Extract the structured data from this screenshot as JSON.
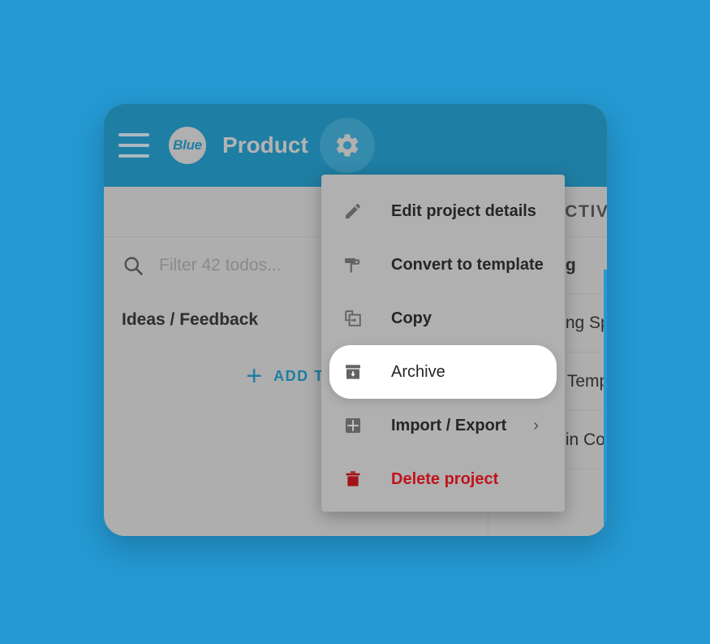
{
  "page": {
    "background_color": "#2499d3"
  },
  "window": {
    "header": {
      "background_color": "#1f7ea3",
      "menu_icon": "hamburger-menu-icon",
      "logo_text": "Blue",
      "project_title": "Product",
      "settings_icon": "gear-icon"
    },
    "board": {
      "tabs": [
        {
          "label": "ACTIVITY"
        }
      ],
      "filter": {
        "icon": "search-icon",
        "placeholder": "Filter 42 todos...",
        "value": ""
      },
      "columns": [
        {
          "title": "Ideas / Feedback",
          "add_button": {
            "icon": "plus-icon",
            "label": "ADD TODO"
          },
          "tasks": []
        },
        {
          "title": "Backlog",
          "tasks": [
            {
              "label": "Improving Speed"
            },
            {
              "label": "Project Templates"
            },
            {
              "label": "Emails in Comments"
            }
          ]
        }
      ]
    }
  },
  "settings_menu": {
    "items": [
      {
        "label": "Edit project details",
        "icon": "pencil-icon",
        "highlighted": false,
        "danger": false,
        "has_submenu": false
      },
      {
        "label": "Convert to template",
        "icon": "paint-roller-icon",
        "highlighted": false,
        "danger": false,
        "has_submenu": false
      },
      {
        "label": "Copy",
        "icon": "copy-icon",
        "highlighted": false,
        "danger": false,
        "has_submenu": false
      },
      {
        "label": "Archive",
        "icon": "archive-icon",
        "highlighted": true,
        "danger": false,
        "has_submenu": false
      },
      {
        "label": "Import / Export",
        "icon": "import-export-icon",
        "highlighted": false,
        "danger": false,
        "has_submenu": true,
        "submenu_chevron": "›"
      },
      {
        "label": "Delete project",
        "icon": "trash-icon",
        "highlighted": false,
        "danger": true,
        "has_submenu": false
      }
    ],
    "danger_color": "#c1131c"
  }
}
